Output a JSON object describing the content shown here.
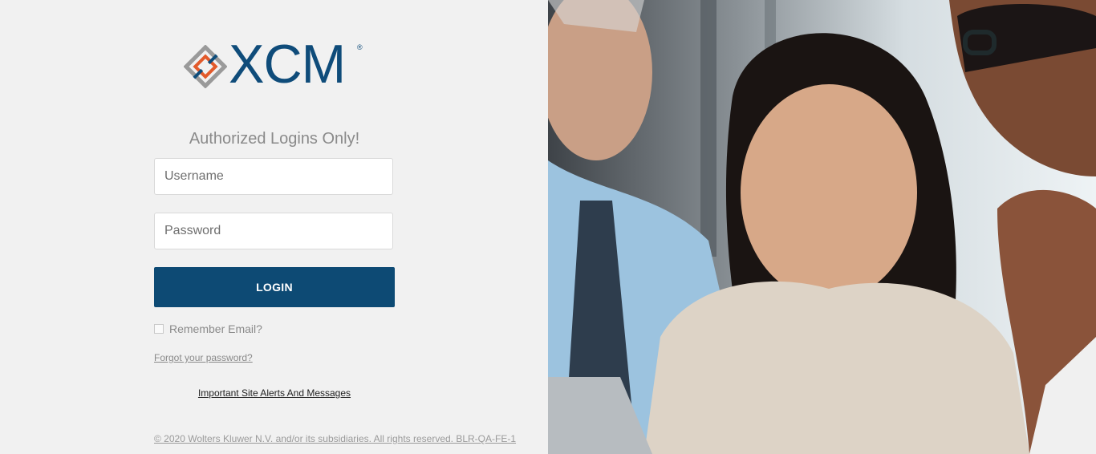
{
  "brand": {
    "name": "XCM",
    "registered_mark": "®"
  },
  "login_form": {
    "heading": "Authorized Logins Only!",
    "username_placeholder": "Username",
    "password_placeholder": "Password",
    "login_label": "LOGIN",
    "remember_label": "Remember Email?",
    "forgot_link": "Forgot your password?",
    "alerts_link": "Important Site Alerts And Messages"
  },
  "footer": {
    "copyright": "© 2020 Wolters Kluwer N.V. and/or its subsidiaries. All rights reserved. BLR-QA-FE-1"
  },
  "colors": {
    "brand_blue": "#0f4c7a",
    "button_blue": "#0d4a74",
    "accent_orange": "#e25a2b",
    "logo_gray": "#8c8c8c"
  }
}
